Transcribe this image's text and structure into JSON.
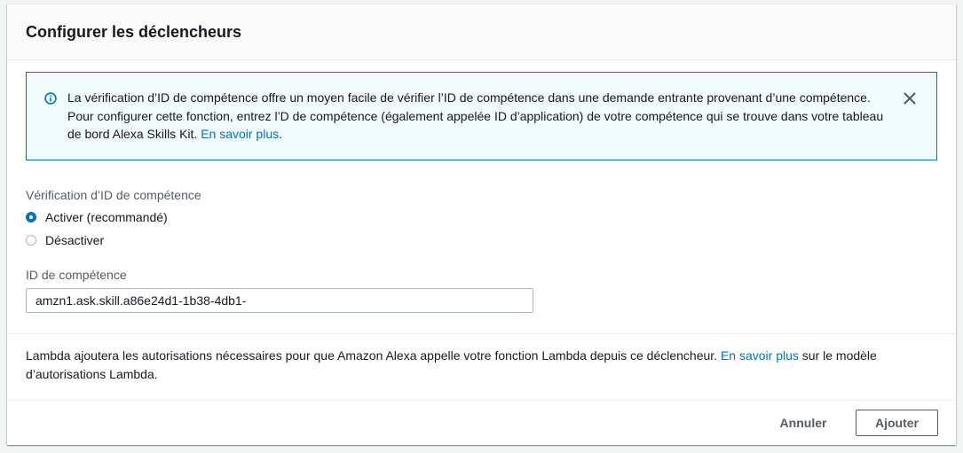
{
  "dialog": {
    "title": "Configurer les déclencheurs"
  },
  "info": {
    "text": "La vérification d’ID de compétence offre un moyen facile de vérifier l’ID de compétence dans une demande entrante provenant d’une compétence. Pour configurer cette fonction, entrez l’D de compétence (également appelée ID d’application) de votre compétence qui se trouve dans votre tableau de bord Alexa Skills Kit.",
    "link": "En savoir plus",
    "trailing": ".",
    "icon": "info-circle-icon",
    "close_icon": "close-icon"
  },
  "verification": {
    "label": "Vérification d’ID de compétence",
    "options": [
      {
        "label": "Activer (recommandé)",
        "checked": true
      },
      {
        "label": "Désactiver",
        "checked": false
      }
    ]
  },
  "skill_id": {
    "label": "ID de compétence",
    "value": "amzn1.ask.skill.a86e24d1-1b38-4db1-"
  },
  "note": {
    "before": "Lambda ajoutera les autorisations nécessaires pour que Amazon Alexa appelle votre fonction Lambda depuis ce déclencheur.",
    "link": "En savoir plus",
    "after": "sur le modèle d’autorisations Lambda."
  },
  "actions": {
    "cancel": "Annuler",
    "add": "Ajouter"
  },
  "colors": {
    "accent": "#0073bb",
    "info_background": "#f1faff",
    "text": "#16191f",
    "secondary_text": "#545b64"
  }
}
